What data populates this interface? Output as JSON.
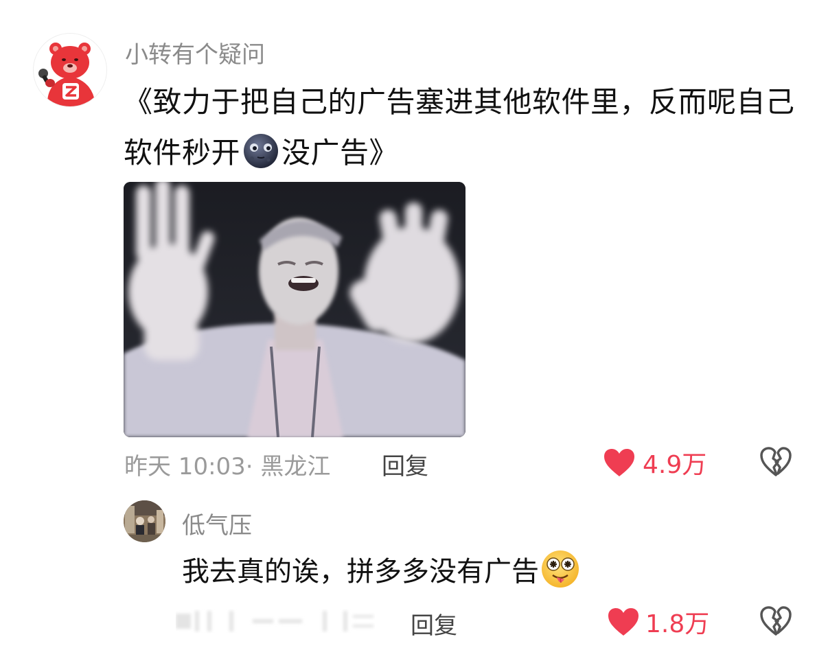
{
  "main_comment": {
    "avatar": "red-bear-microphone-avatar",
    "username": "小转有个疑问",
    "text_part1": "《致力于把自己的广告塞进其他软件里，反而呢自己软件秒开",
    "emoji": "new-moon-face-emoji",
    "text_part2": "没广告》",
    "image": "meme-man-waving-hands",
    "meta": "昨天 10:03· 黑龙江",
    "reply_label": "回复",
    "like_icon": "heart-icon",
    "like_count": "4.9万",
    "dislike_icon": "broken-heart-icon"
  },
  "reply_comment": {
    "avatar": "crowd-photo-avatar",
    "username": "低气压",
    "text": "我去真的诶，拼多多没有广告",
    "emoji": "zany-face-emoji",
    "meta": "",
    "reply_label": "回复",
    "like_icon": "heart-icon",
    "like_count": "1.8万",
    "dislike_icon": "broken-heart-icon"
  },
  "colors": {
    "like": "#ef3d52",
    "username": "#8a8a8a",
    "meta": "#9a9a9a",
    "brand_red": "#e8353a"
  }
}
